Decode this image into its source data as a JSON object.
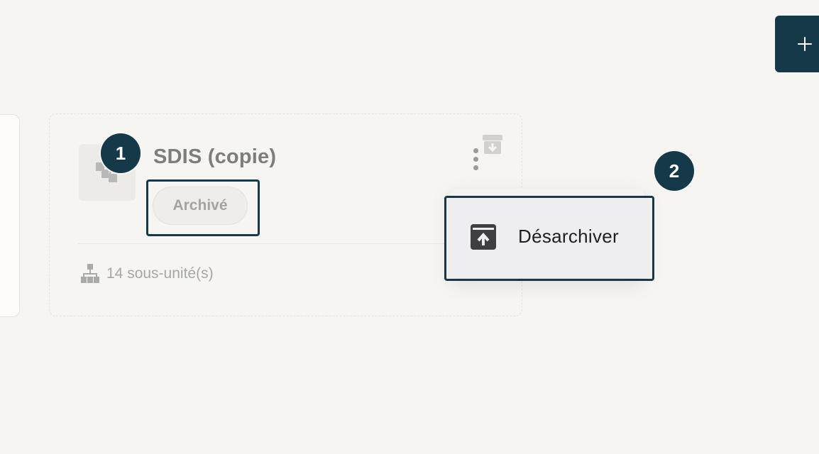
{
  "header": {
    "add_button_label": "+"
  },
  "org_card": {
    "title": "SDIS (copie)",
    "status": "Archivé",
    "subunits": "14 sous-unité(s)",
    "icon": "hierarchy-icon"
  },
  "menu": {
    "items": [
      {
        "label": "Désarchiver",
        "icon": "unarchive-icon"
      }
    ]
  },
  "callouts": [
    "1",
    "2"
  ],
  "colors": {
    "accent": "#16394a",
    "background": "#f6f5f2",
    "muted_text": "#a6a6a6",
    "title_text": "#7d7d7d"
  }
}
